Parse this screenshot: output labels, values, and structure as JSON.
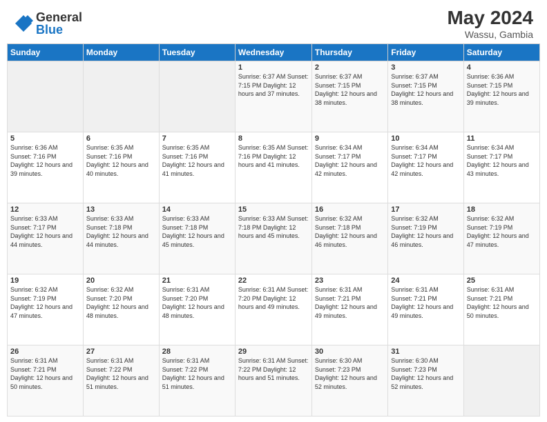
{
  "header": {
    "logo_general": "General",
    "logo_blue": "Blue",
    "month_year": "May 2024",
    "location": "Wassu, Gambia"
  },
  "calendar": {
    "days_of_week": [
      "Sunday",
      "Monday",
      "Tuesday",
      "Wednesday",
      "Thursday",
      "Friday",
      "Saturday"
    ],
    "weeks": [
      [
        {
          "day": "",
          "info": ""
        },
        {
          "day": "",
          "info": ""
        },
        {
          "day": "",
          "info": ""
        },
        {
          "day": "1",
          "info": "Sunrise: 6:37 AM\nSunset: 7:15 PM\nDaylight: 12 hours\nand 37 minutes."
        },
        {
          "day": "2",
          "info": "Sunrise: 6:37 AM\nSunset: 7:15 PM\nDaylight: 12 hours\nand 38 minutes."
        },
        {
          "day": "3",
          "info": "Sunrise: 6:37 AM\nSunset: 7:15 PM\nDaylight: 12 hours\nand 38 minutes."
        },
        {
          "day": "4",
          "info": "Sunrise: 6:36 AM\nSunset: 7:15 PM\nDaylight: 12 hours\nand 39 minutes."
        }
      ],
      [
        {
          "day": "5",
          "info": "Sunrise: 6:36 AM\nSunset: 7:16 PM\nDaylight: 12 hours\nand 39 minutes."
        },
        {
          "day": "6",
          "info": "Sunrise: 6:35 AM\nSunset: 7:16 PM\nDaylight: 12 hours\nand 40 minutes."
        },
        {
          "day": "7",
          "info": "Sunrise: 6:35 AM\nSunset: 7:16 PM\nDaylight: 12 hours\nand 41 minutes."
        },
        {
          "day": "8",
          "info": "Sunrise: 6:35 AM\nSunset: 7:16 PM\nDaylight: 12 hours\nand 41 minutes."
        },
        {
          "day": "9",
          "info": "Sunrise: 6:34 AM\nSunset: 7:17 PM\nDaylight: 12 hours\nand 42 minutes."
        },
        {
          "day": "10",
          "info": "Sunrise: 6:34 AM\nSunset: 7:17 PM\nDaylight: 12 hours\nand 42 minutes."
        },
        {
          "day": "11",
          "info": "Sunrise: 6:34 AM\nSunset: 7:17 PM\nDaylight: 12 hours\nand 43 minutes."
        }
      ],
      [
        {
          "day": "12",
          "info": "Sunrise: 6:33 AM\nSunset: 7:17 PM\nDaylight: 12 hours\nand 44 minutes."
        },
        {
          "day": "13",
          "info": "Sunrise: 6:33 AM\nSunset: 7:18 PM\nDaylight: 12 hours\nand 44 minutes."
        },
        {
          "day": "14",
          "info": "Sunrise: 6:33 AM\nSunset: 7:18 PM\nDaylight: 12 hours\nand 45 minutes."
        },
        {
          "day": "15",
          "info": "Sunrise: 6:33 AM\nSunset: 7:18 PM\nDaylight: 12 hours\nand 45 minutes."
        },
        {
          "day": "16",
          "info": "Sunrise: 6:32 AM\nSunset: 7:18 PM\nDaylight: 12 hours\nand 46 minutes."
        },
        {
          "day": "17",
          "info": "Sunrise: 6:32 AM\nSunset: 7:19 PM\nDaylight: 12 hours\nand 46 minutes."
        },
        {
          "day": "18",
          "info": "Sunrise: 6:32 AM\nSunset: 7:19 PM\nDaylight: 12 hours\nand 47 minutes."
        }
      ],
      [
        {
          "day": "19",
          "info": "Sunrise: 6:32 AM\nSunset: 7:19 PM\nDaylight: 12 hours\nand 47 minutes."
        },
        {
          "day": "20",
          "info": "Sunrise: 6:32 AM\nSunset: 7:20 PM\nDaylight: 12 hours\nand 48 minutes."
        },
        {
          "day": "21",
          "info": "Sunrise: 6:31 AM\nSunset: 7:20 PM\nDaylight: 12 hours\nand 48 minutes."
        },
        {
          "day": "22",
          "info": "Sunrise: 6:31 AM\nSunset: 7:20 PM\nDaylight: 12 hours\nand 49 minutes."
        },
        {
          "day": "23",
          "info": "Sunrise: 6:31 AM\nSunset: 7:21 PM\nDaylight: 12 hours\nand 49 minutes."
        },
        {
          "day": "24",
          "info": "Sunrise: 6:31 AM\nSunset: 7:21 PM\nDaylight: 12 hours\nand 49 minutes."
        },
        {
          "day": "25",
          "info": "Sunrise: 6:31 AM\nSunset: 7:21 PM\nDaylight: 12 hours\nand 50 minutes."
        }
      ],
      [
        {
          "day": "26",
          "info": "Sunrise: 6:31 AM\nSunset: 7:21 PM\nDaylight: 12 hours\nand 50 minutes."
        },
        {
          "day": "27",
          "info": "Sunrise: 6:31 AM\nSunset: 7:22 PM\nDaylight: 12 hours\nand 51 minutes."
        },
        {
          "day": "28",
          "info": "Sunrise: 6:31 AM\nSunset: 7:22 PM\nDaylight: 12 hours\nand 51 minutes."
        },
        {
          "day": "29",
          "info": "Sunrise: 6:31 AM\nSunset: 7:22 PM\nDaylight: 12 hours\nand 51 minutes."
        },
        {
          "day": "30",
          "info": "Sunrise: 6:30 AM\nSunset: 7:23 PM\nDaylight: 12 hours\nand 52 minutes."
        },
        {
          "day": "31",
          "info": "Sunrise: 6:30 AM\nSunset: 7:23 PM\nDaylight: 12 hours\nand 52 minutes."
        },
        {
          "day": "",
          "info": ""
        }
      ]
    ]
  }
}
